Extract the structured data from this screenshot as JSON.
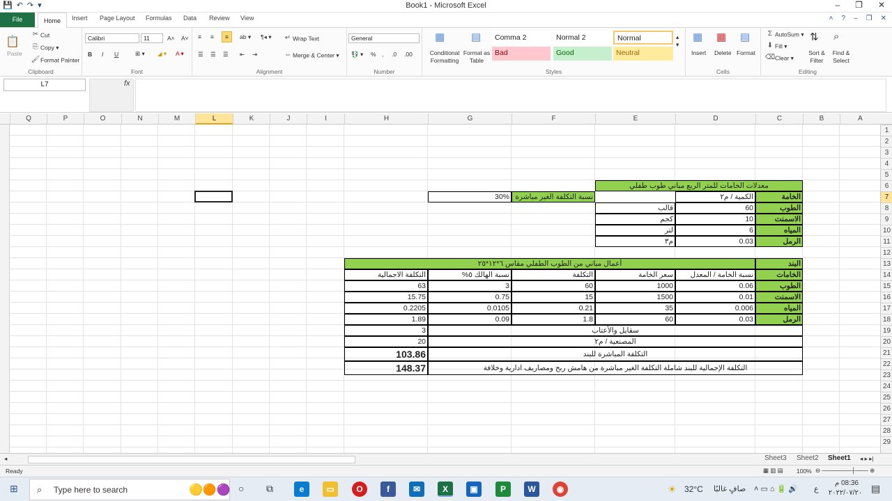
{
  "window": {
    "title": "Book1 - Microsoft Excel",
    "controls": [
      "–",
      "❐",
      "✕"
    ]
  },
  "ribbon_tabs": [
    "File",
    "Home",
    "Insert",
    "Page Layout",
    "Formulas",
    "Data",
    "Review",
    "View"
  ],
  "clipboard": {
    "paste": "Paste",
    "cut": "Cut",
    "copy": "Copy",
    "format_painter": "Format Painter",
    "label": "Clipboard"
  },
  "font": {
    "name": "Calibri",
    "size": "11",
    "bold": "B",
    "italic": "I",
    "underline": "U",
    "label": "Font"
  },
  "alignment": {
    "wrap": "Wrap Text",
    "merge": "Merge & Center",
    "label": "Alignment"
  },
  "number": {
    "format": "General",
    "label": "Number"
  },
  "styles": {
    "conditional": "Conditional Formatting",
    "format_table": "Format as Table",
    "comma2": "Comma 2",
    "normal2": "Normal 2",
    "normal": "Normal",
    "bad": "Bad",
    "good": "Good",
    "neutral": "Neutral",
    "label": "Styles"
  },
  "cells": {
    "insert": "Insert",
    "delete": "Delete",
    "format": "Format",
    "label": "Cells"
  },
  "editing": {
    "autosum": "AutoSum",
    "fill": "Fill",
    "clear": "Clear",
    "sort": "Sort & Filter",
    "find": "Find & Select",
    "label": "Editing"
  },
  "formula_bar": {
    "name_box": "L7",
    "fx": "fx",
    "content": ""
  },
  "columns": [
    "Q",
    "P",
    "O",
    "N",
    "M",
    "L",
    "K",
    "J",
    "I",
    "H",
    "G",
    "F",
    "E",
    "D",
    "C",
    "B",
    "A"
  ],
  "rows": [
    "1",
    "2",
    "3",
    "4",
    "5",
    "6",
    "7",
    "8",
    "9",
    "10",
    "11",
    "12",
    "13",
    "14",
    "15",
    "16",
    "17",
    "18",
    "19",
    "20",
    "21",
    "22",
    "23",
    "24",
    "25",
    "26",
    "27",
    "28",
    "29"
  ],
  "table1": {
    "title": "معدلات الخامات للمتر الربع مباني طوب طفلي",
    "h_material": "الخامة",
    "h_qty": "الكمية / م٢",
    "indirect_label": "نسبة التكلفة الغير مباشرة",
    "indirect_value": "30%",
    "rows": [
      {
        "name": "الطوب",
        "qty": "60",
        "unit": "قالب"
      },
      {
        "name": "الاسمنت",
        "qty": "10",
        "unit": "كجم"
      },
      {
        "name": "المياه",
        "qty": "6",
        "unit": "لتر"
      },
      {
        "name": "الرمل",
        "qty": "0.03",
        "unit": "م٣"
      }
    ]
  },
  "table2": {
    "h_item": "البند",
    "title": "أعمال مباني من الطوب الطفلي مقاس ٦*١٢*٢٥",
    "h_materials": "الخامات",
    "h_ratio": "نسبة الخامة / المعدل",
    "h_price": "سعر الخامة",
    "h_cost": "التكلفة",
    "h_waste": "نسبة الهالك ٥%",
    "h_total": "التكلفة الاجمالية",
    "rows": [
      {
        "name": "الطوب",
        "ratio": "0.06",
        "price": "1000",
        "cost": "60",
        "waste": "3",
        "total": "63"
      },
      {
        "name": "الاسمنت",
        "ratio": "0.01",
        "price": "1500",
        "cost": "15",
        "waste": "0.75",
        "total": "15.75"
      },
      {
        "name": "المياه",
        "ratio": "0.006",
        "price": "35",
        "cost": "0.21",
        "waste": "0.0105",
        "total": "0.2205"
      },
      {
        "name": "الرمل",
        "ratio": "0.03",
        "price": "60",
        "cost": "1.8",
        "waste": "0.09",
        "total": "1.89"
      }
    ],
    "scaffold_label": "سقايل والأعتاب",
    "scaffold_value": "3",
    "labor_label": "المصنعية / م٢",
    "labor_value": "20",
    "direct_label": "التكلفة المباشرة للبند",
    "direct_value": "103.86",
    "total_label": "التكلفة الإجمالية للبند شاملة التكلفة الغير مباشرة من هامش ربح ومصاريف ادارية وخلافة",
    "total_value": "148.37"
  },
  "sheets": [
    "Sheet3",
    "Sheet2",
    "Sheet1"
  ],
  "status": {
    "ready": "Ready",
    "zoom": "100%"
  },
  "taskbar": {
    "search": "Type here to search",
    "weather": "32°C",
    "weather_text": "صافٍ غالبًا",
    "time": "08:36 م",
    "date": "٢٠٢٢/٠٧/٢٠",
    "lang": "ع"
  }
}
